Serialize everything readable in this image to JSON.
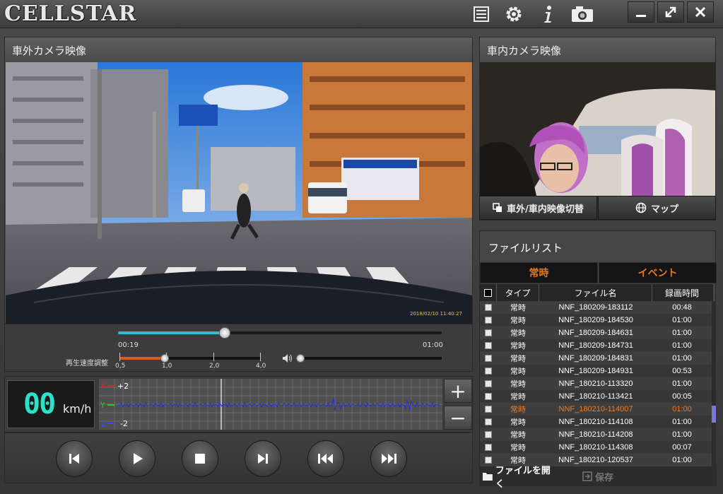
{
  "app": {
    "logo": "CELLSTAR"
  },
  "titlebar": {
    "icons": [
      "list-icon",
      "gear-icon",
      "info-icon",
      "camera-icon"
    ],
    "window_buttons": [
      "minimize-icon",
      "maximize-icon",
      "close-icon"
    ]
  },
  "exterior": {
    "title": "車外カメラ映像",
    "timestamp": "2018/02/10 11:40:27"
  },
  "interior": {
    "title": "車内カメラ映像"
  },
  "buttons": {
    "switch_label": "車外/車内映像切替",
    "map_label": "マップ"
  },
  "playback": {
    "current_time": "00:19",
    "total_time": "01:00",
    "progress": 0.33,
    "speed_label": "再生速度調整",
    "speed_ticks": [
      "0,5",
      "1,0",
      "2,0",
      "4,0"
    ],
    "speed_value": "1,0",
    "volume": 0.0
  },
  "meter": {
    "speed": "00",
    "unit": "km/h"
  },
  "gsensor": {
    "x_label": "X",
    "y_label": "Y",
    "z_label": "Z",
    "top_value": "+2",
    "bottom_value": "-2",
    "zoom_in": "+",
    "zoom_out": "−"
  },
  "filelist": {
    "title": "ファイルリスト",
    "tabs": [
      "常時",
      "イベント"
    ],
    "columns": [
      "タイプ",
      "ファイル名",
      "録画時間"
    ],
    "rows": [
      {
        "type": "常時",
        "name": "NNF_180209-183112",
        "duration": "00:48"
      },
      {
        "type": "常時",
        "name": "NNF_180209-184530",
        "duration": "01:00"
      },
      {
        "type": "常時",
        "name": "NNF_180209-184631",
        "duration": "01:00"
      },
      {
        "type": "常時",
        "name": "NNF_180209-184731",
        "duration": "01:00"
      },
      {
        "type": "常時",
        "name": "NNF_180209-184831",
        "duration": "01:00"
      },
      {
        "type": "常時",
        "name": "NNF_180209-184931",
        "duration": "00:53"
      },
      {
        "type": "常時",
        "name": "NNF_180210-113320",
        "duration": "01:00"
      },
      {
        "type": "常時",
        "name": "NNF_180210-113421",
        "duration": "00:05"
      },
      {
        "type": "常時",
        "name": "NNF_180210-114007",
        "duration": "01:00",
        "selected": true
      },
      {
        "type": "常時",
        "name": "NNF_180210-114108",
        "duration": "01:00"
      },
      {
        "type": "常時",
        "name": "NNF_180210-114208",
        "duration": "01:00"
      },
      {
        "type": "常時",
        "name": "NNF_180210-114308",
        "duration": "00:07"
      },
      {
        "type": "常時",
        "name": "NNF_180210-120537",
        "duration": "01:00"
      }
    ],
    "open_label": "ファイルを開く",
    "save_label": "保存"
  },
  "colors": {
    "accent_cyan": "#2bc0d8",
    "accent_orange": "#e8781f",
    "speed_digits": "#2de0c8"
  }
}
